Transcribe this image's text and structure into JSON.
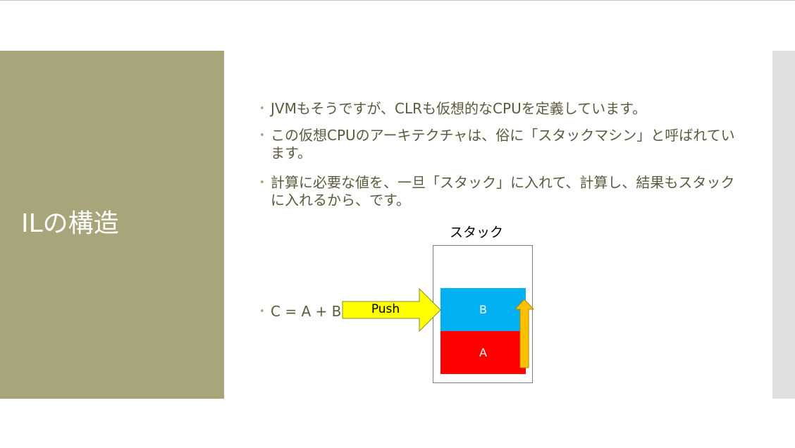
{
  "slide": {
    "title": "ILの構造",
    "bullets": [
      "JVMもそうですが、CLRも仮想的なCPUを定義しています。",
      "この仮想CPUのアーキテクチャは、俗に「スタックマシン」と呼ばれています。",
      "計算に必要な値を、一旦「スタック」に入れて、計算し、結果もスタックに入れるから、です。",
      "C = A + B"
    ],
    "bullet_glyph": "•"
  },
  "diagram": {
    "stack_label": "スタック",
    "push_label": "Push",
    "block_top": "B",
    "block_bottom": "A"
  },
  "colors": {
    "sidebar": "#a8a57b",
    "body_text": "#5c5a3c",
    "block_b": "#00b0f0",
    "block_a": "#ff0000",
    "push_arrow": "#ffff00",
    "up_arrow": "#ffc000"
  }
}
